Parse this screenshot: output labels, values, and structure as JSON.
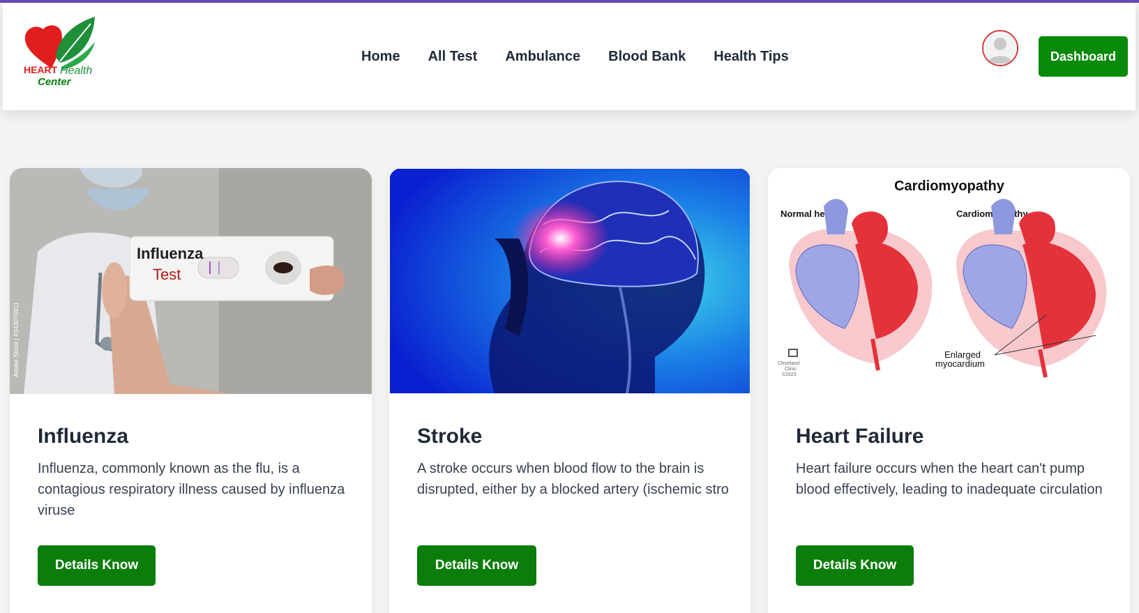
{
  "brand": {
    "logo_word1": "HEART",
    "logo_word2": "Health",
    "logo_word3": "Center",
    "colors": {
      "red": "#e11d1d",
      "green": "#0a8a0a",
      "accent_top": "#6b46b8"
    }
  },
  "nav": {
    "links": [
      "Home",
      "All Test",
      "Ambulance",
      "Blood Bank",
      "Health Tips"
    ],
    "dashboard_label": "Dashboard",
    "avatar_icon": "user-avatar-icon"
  },
  "cards": [
    {
      "title": "Influenza",
      "description": "Influenza, commonly known as the flu, is a contagious respiratory illness caused by influenza viruse",
      "button": "Details Know",
      "image_text": {
        "line1": "Influenza",
        "line2": "Test",
        "watermark": "Adobe Stock | #343070911"
      }
    },
    {
      "title": "Stroke",
      "description": "A stroke occurs when blood flow to the brain is disrupted, either by a blocked artery (ischemic stro",
      "button": "Details Know",
      "image_text": {}
    },
    {
      "title": "Heart Failure",
      "description": "Heart failure occurs when the heart can't pump blood effectively, leading to inadequate circulation",
      "button": "Details Know",
      "image_text": {
        "heading": "Cardiomyopathy",
        "left_label": "Normal heart",
        "right_label": "Cardiomyopathy",
        "annotation1": "Enlarged",
        "annotation2": "myocardium",
        "credit1": "Cleveland",
        "credit2": "Clinic",
        "credit3": "©2023"
      }
    }
  ]
}
